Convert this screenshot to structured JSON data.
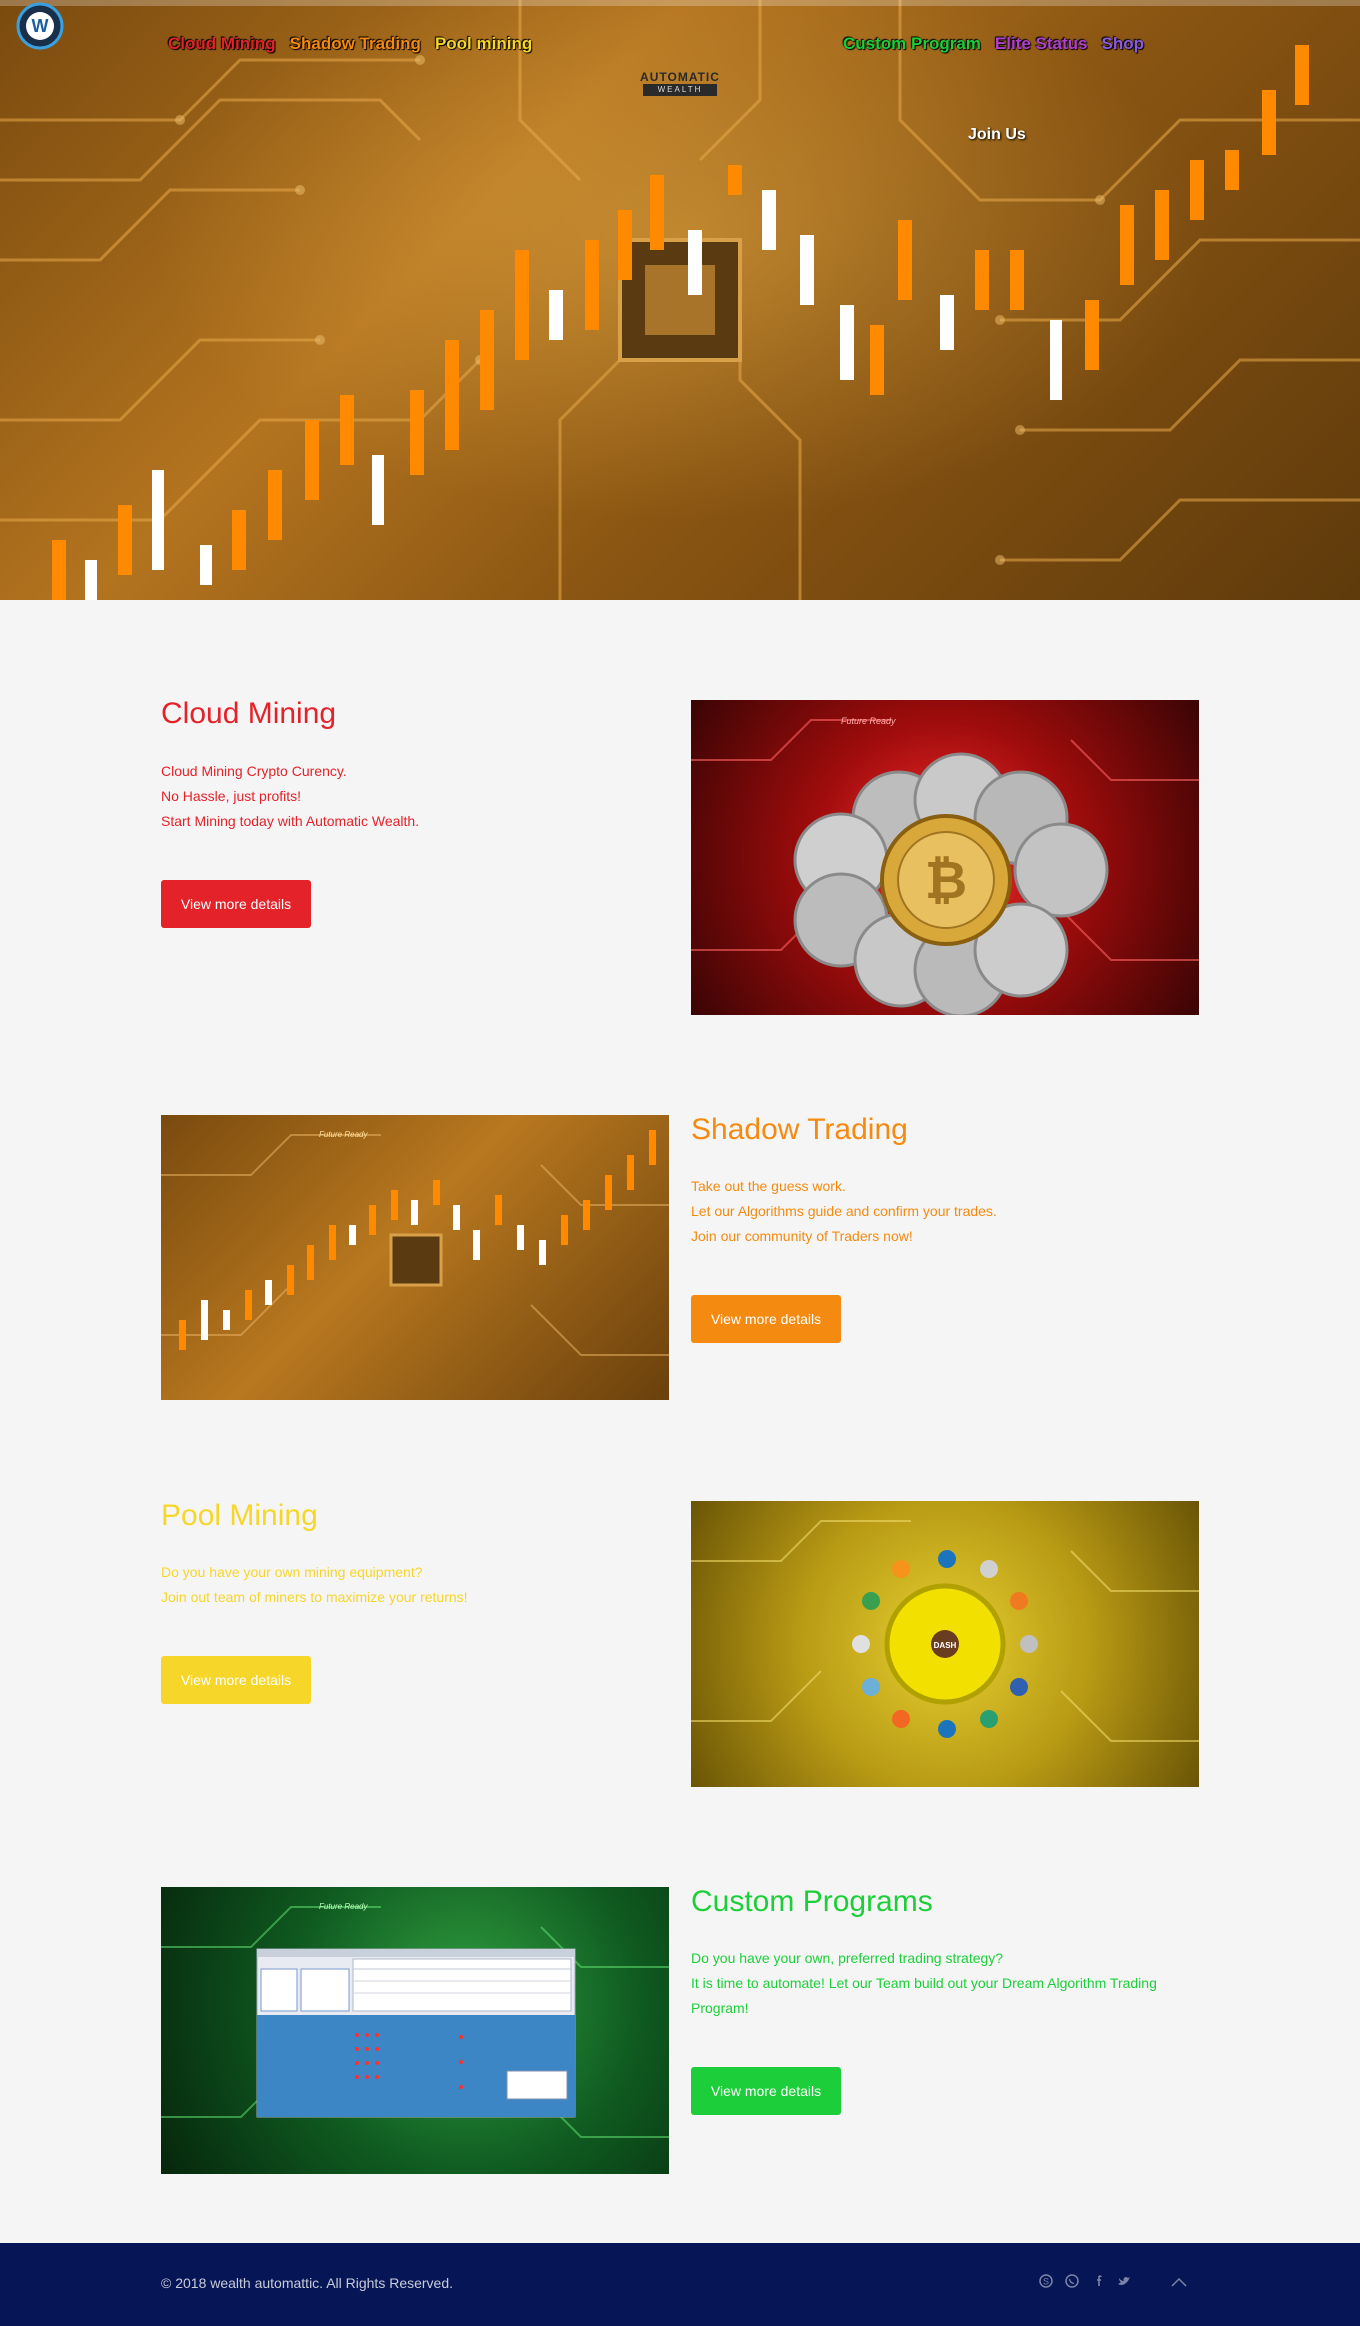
{
  "nav": {
    "left": [
      {
        "label": "Cloud Mining",
        "color": "#e4222a"
      },
      {
        "label": "Shadow Trading",
        "color": "#f58a10"
      },
      {
        "label": "Pool mining",
        "color": "#f7d62a"
      }
    ],
    "right": [
      {
        "label": "Custom Program",
        "color": "#1ccf3a"
      },
      {
        "label": "Elite Status",
        "color": "#b040d0"
      },
      {
        "label": "Shop",
        "color": "#8a5ae0"
      }
    ],
    "join_label": "Join Us"
  },
  "logo": {
    "letter": "W",
    "text": "AUTOMATIC",
    "sub": "WEALTH"
  },
  "sections": [
    {
      "title": "Cloud Mining",
      "lines": [
        "Cloud Mining Crypto Curency.",
        "No Hassle, just profits!",
        "Start Mining today with Automatic Wealth."
      ],
      "button": "View more details",
      "color": "#e4222a"
    },
    {
      "title": "Shadow Trading",
      "lines": [
        "Take out the guess work.",
        "Let our Algorithms guide and confirm your trades.",
        "Join our community of Traders now!"
      ],
      "button": "View more details",
      "color": "#f58a10"
    },
    {
      "title": "Pool Mining",
      "lines": [
        "Do you have your own mining equipment?",
        "Join out team of miners to maximize your returns!"
      ],
      "button": "View more details",
      "color": "#f7d62a"
    },
    {
      "title": "Custom Programs",
      "lines": [
        "Do you have your own, preferred trading strategy?",
        "It is time to automate! Let our Team build out your Dream Algorithm Trading",
        "Program!"
      ],
      "button": "View more details",
      "color": "#1ccf3a"
    }
  ],
  "images": {
    "cloud_badge": "Future Ready",
    "shadow_badge": "Future Ready",
    "pool_center": "DASH",
    "custom_badge": "Future Ready"
  },
  "footer": {
    "copyright": "© 2018 wealth automattic. All Rights Reserved.",
    "icons": [
      "skype-icon",
      "whatsapp-icon",
      "facebook-icon",
      "twitter-icon",
      "scroll-top-icon"
    ],
    "bg": "#061556"
  }
}
